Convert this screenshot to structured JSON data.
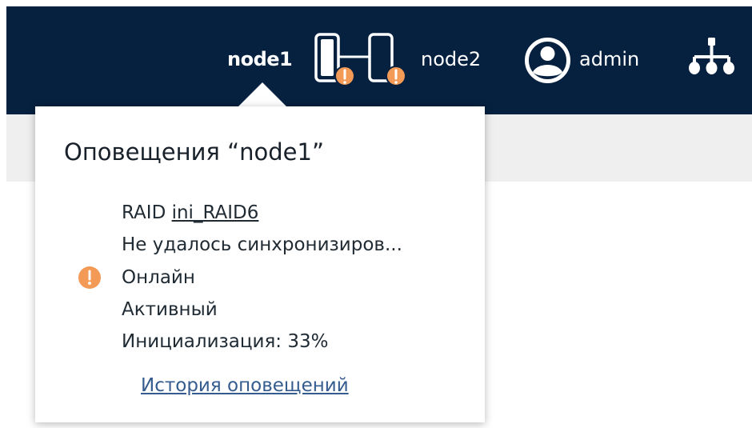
{
  "header": {
    "node1_label": "node1",
    "node2_label": "node2",
    "user_label": "admin",
    "icons": {
      "cluster": "cluster-warning-icon",
      "user": "user-icon",
      "network": "network-icon"
    },
    "colors": {
      "background": "#06203f",
      "warning": "#f49a57"
    }
  },
  "popup": {
    "title": "Оповещения “node1”",
    "raid_prefix": "RAID",
    "raid_name": "ini_RAID6",
    "sync_message": "Не удалось синхронизиров...",
    "status": "Онлайн",
    "state": "Активный",
    "init_progress": "Инициализация: 33%",
    "history_link": "История оповещений"
  }
}
